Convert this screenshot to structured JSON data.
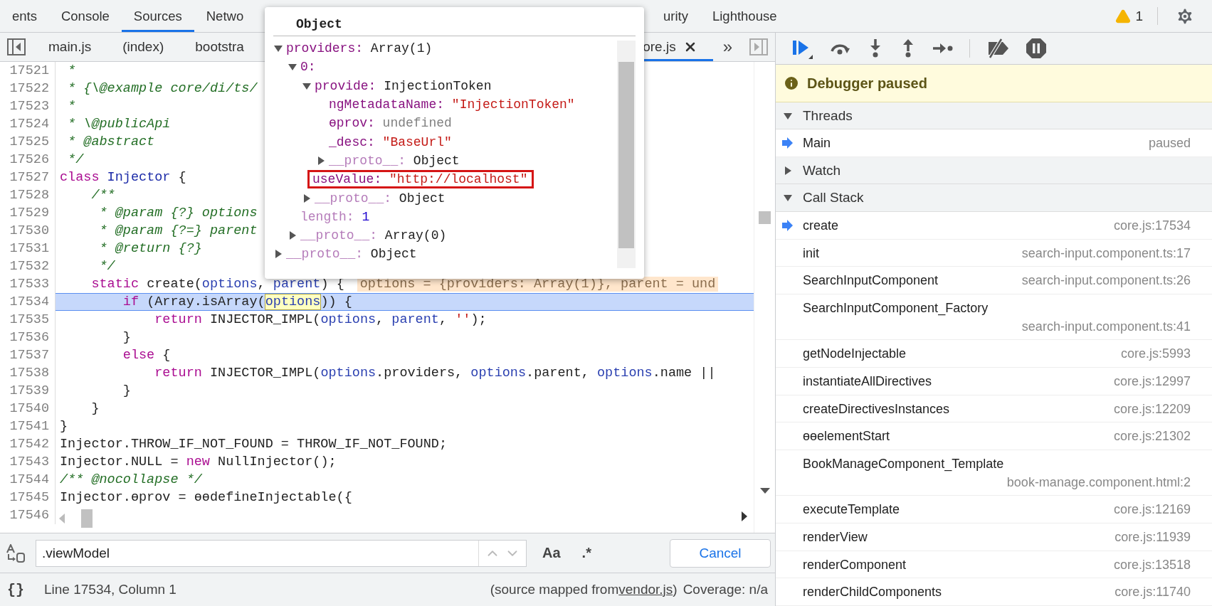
{
  "tabs": [
    {
      "label": "ents",
      "selected": false
    },
    {
      "label": "Console",
      "selected": false
    },
    {
      "label": "Sources",
      "selected": true
    },
    {
      "label": "Netwo",
      "selected": false
    },
    {
      "label": "urity",
      "selected": false
    },
    {
      "label": "Lighthouse",
      "selected": false
    }
  ],
  "warnings": "1",
  "file_tabs": [
    {
      "label": "main.js",
      "selected": false
    },
    {
      "label": "(index)",
      "selected": false
    },
    {
      "label": "bootstra",
      "selected": false
    },
    {
      "label": "ore.js",
      "selected": true
    }
  ],
  "file_tabs_overflow": "»",
  "code_lines": [
    {
      "number": "17521",
      "current": false,
      "segments": [
        {
          "kind": "comment",
          "text": " *"
        }
      ]
    },
    {
      "number": "17522",
      "current": false,
      "segments": [
        {
          "kind": "comment",
          "text": " * {\\@example core/di/ts/"
        }
      ]
    },
    {
      "number": "17523",
      "current": false,
      "segments": [
        {
          "kind": "comment",
          "text": " *"
        }
      ]
    },
    {
      "number": "17524",
      "current": false,
      "segments": [
        {
          "kind": "comment",
          "text": " * \\@publicApi"
        }
      ]
    },
    {
      "number": "17525",
      "current": false,
      "segments": [
        {
          "kind": "comment",
          "text": " * @abstract"
        }
      ]
    },
    {
      "number": "17526",
      "current": false,
      "segments": [
        {
          "kind": "comment",
          "text": " */"
        }
      ]
    },
    {
      "number": "17527",
      "current": false,
      "segments": [
        {
          "kind": "keyword",
          "text": "class"
        },
        {
          "kind": "def",
          "text": " Injector"
        },
        {
          "kind": "plain",
          "text": " {"
        }
      ]
    },
    {
      "number": "17528",
      "current": false,
      "segments": [
        {
          "kind": "comment",
          "text": "    /**"
        }
      ]
    },
    {
      "number": "17529",
      "current": false,
      "segments": [
        {
          "kind": "comment",
          "text": "     * @param {?} options"
        }
      ]
    },
    {
      "number": "17530",
      "current": false,
      "segments": [
        {
          "kind": "comment",
          "text": "     * @param {?=} parent"
        }
      ]
    },
    {
      "number": "17531",
      "current": false,
      "segments": [
        {
          "kind": "comment",
          "text": "     * @return {?}"
        }
      ]
    },
    {
      "number": "17532",
      "current": false,
      "segments": [
        {
          "kind": "comment",
          "text": "     */"
        }
      ]
    },
    {
      "number": "17533",
      "current": false,
      "segments": [
        {
          "kind": "keyword",
          "text": "    static"
        },
        {
          "kind": "plain",
          "text": " create("
        },
        {
          "kind": "var",
          "text": "options"
        },
        {
          "kind": "plain",
          "text": ", "
        },
        {
          "kind": "var",
          "text": "parent"
        },
        {
          "kind": "plain",
          "text": ") {"
        }
      ],
      "inline_value": "options = {providers: Array(1)}, parent = und"
    },
    {
      "number": "17534",
      "current": true,
      "segments": [
        {
          "kind": "keyword",
          "text": "        if"
        },
        {
          "kind": "plain",
          "text": " (Array.isArray("
        },
        {
          "kind": "match",
          "text": "options"
        },
        {
          "kind": "plain",
          "text": ")) {"
        }
      ]
    },
    {
      "number": "17535",
      "current": false,
      "segments": [
        {
          "kind": "keyword",
          "text": "            return"
        },
        {
          "kind": "plain",
          "text": " INJECTOR_IMPL("
        },
        {
          "kind": "var",
          "text": "options"
        },
        {
          "kind": "plain",
          "text": ", "
        },
        {
          "kind": "var",
          "text": "parent"
        },
        {
          "kind": "plain",
          "text": ", "
        },
        {
          "kind": "string",
          "text": "''"
        },
        {
          "kind": "plain",
          "text": ");"
        }
      ]
    },
    {
      "number": "17536",
      "current": false,
      "segments": [
        {
          "kind": "plain",
          "text": "        }"
        }
      ]
    },
    {
      "number": "17537",
      "current": false,
      "segments": [
        {
          "kind": "keyword",
          "text": "        else"
        },
        {
          "kind": "plain",
          "text": " {"
        }
      ]
    },
    {
      "number": "17538",
      "current": false,
      "segments": [
        {
          "kind": "keyword",
          "text": "            return"
        },
        {
          "kind": "plain",
          "text": " INJECTOR_IMPL("
        },
        {
          "kind": "var",
          "text": "options"
        },
        {
          "kind": "plain",
          "text": ".providers, "
        },
        {
          "kind": "var",
          "text": "options"
        },
        {
          "kind": "plain",
          "text": ".parent, "
        },
        {
          "kind": "var",
          "text": "options"
        },
        {
          "kind": "plain",
          "text": ".name ||"
        }
      ]
    },
    {
      "number": "17539",
      "current": false,
      "segments": [
        {
          "kind": "plain",
          "text": "        }"
        }
      ]
    },
    {
      "number": "17540",
      "current": false,
      "segments": [
        {
          "kind": "plain",
          "text": "    }"
        }
      ]
    },
    {
      "number": "17541",
      "current": false,
      "segments": [
        {
          "kind": "plain",
          "text": "}"
        }
      ]
    },
    {
      "number": "17542",
      "current": false,
      "segments": [
        {
          "kind": "plain",
          "text": "Injector.THROW_IF_NOT_FOUND = THROW_IF_NOT_FOUND;"
        }
      ]
    },
    {
      "number": "17543",
      "current": false,
      "segments": [
        {
          "kind": "plain",
          "text": "Injector.NULL = "
        },
        {
          "kind": "keyword",
          "text": "new"
        },
        {
          "kind": "plain",
          "text": " NullInjector();"
        }
      ]
    },
    {
      "number": "17544",
      "current": false,
      "segments": [
        {
          "kind": "comment",
          "text": "/** @nocollapse */"
        }
      ]
    },
    {
      "number": "17545",
      "current": false,
      "segments": [
        {
          "kind": "plain",
          "text": "Injector.ɵprov = ɵɵdefineInjectable({"
        }
      ]
    },
    {
      "number": "17546",
      "current": false
    }
  ],
  "popup": {
    "title": "Object",
    "tree": [
      {
        "key": "providers:",
        "value": "Array(1)",
        "kind": "object",
        "internal": false,
        "expanded": true,
        "outlined": false,
        "children": [
          {
            "key": "0:",
            "kind": "none",
            "internal": false,
            "expanded": true,
            "outlined": false,
            "children": [
              {
                "key": "provide:",
                "value": "InjectionToken",
                "kind": "object",
                "internal": false,
                "expanded": true,
                "outlined": false,
                "children": [
                  {
                    "key": "ngMetadataName:",
                    "value": "\"InjectionToken\"",
                    "kind": "string",
                    "internal": false,
                    "outlined": false
                  },
                  {
                    "key": "ɵprov:",
                    "value": "undefined",
                    "kind": "undefined",
                    "internal": false,
                    "outlined": false
                  },
                  {
                    "key": "_desc:",
                    "value": "\"BaseUrl\"",
                    "kind": "string",
                    "internal": false,
                    "outlined": false
                  },
                  {
                    "key": "__proto__:",
                    "value": "Object",
                    "kind": "object",
                    "internal": true,
                    "expanded": false,
                    "outlined": false
                  }
                ]
              },
              {
                "key": "useValue:",
                "value": "\"http://localhost\"",
                "kind": "string",
                "internal": false,
                "outlined": true
              },
              {
                "key": "__proto__:",
                "value": "Object",
                "kind": "object",
                "internal": true,
                "expanded": false,
                "outlined": false
              }
            ]
          },
          {
            "key": "length:",
            "value": "1",
            "kind": "number",
            "internal": true,
            "outlined": false
          },
          {
            "key": "__proto__:",
            "value": "Array(0)",
            "kind": "object",
            "internal": true,
            "expanded": false,
            "outlined": false
          }
        ]
      },
      {
        "key": "__proto__:",
        "value": "Object",
        "kind": "object",
        "internal": true,
        "expanded": false,
        "outlined": false
      }
    ]
  },
  "search": {
    "value": ".viewModel",
    "match_case": "Aa",
    "regex": ".*",
    "cancel": "Cancel"
  },
  "status_bar": {
    "pretty_print": "{}",
    "position": "Line 17534, Column 1",
    "mapped_prefix": "(source mapped from ",
    "mapped_link": "vendor.js",
    "mapped_suffix": ")",
    "coverage": "Coverage: n/a"
  },
  "paused_banner": "Debugger paused",
  "sections": [
    {
      "kind": "threads",
      "title": "Threads",
      "expanded": true,
      "items": [
        {
          "name": "Main",
          "location": "paused",
          "current": true
        }
      ]
    },
    {
      "kind": "watch",
      "title": "Watch",
      "expanded": false
    },
    {
      "kind": "call_stack",
      "title": "Call Stack",
      "expanded": true,
      "items": [
        {
          "name": "create",
          "location": "core.js:17534",
          "current": true
        },
        {
          "name": "init",
          "location": "search-input.component.ts:17",
          "current": false
        },
        {
          "name": "SearchInputComponent",
          "location": "search-input.component.ts:26",
          "current": false
        },
        {
          "name": "SearchInputComponent_Factory",
          "location": "search-input.component.ts:41",
          "current": false
        },
        {
          "name": "getNodeInjectable",
          "location": "core.js:5993",
          "current": false
        },
        {
          "name": "instantiateAllDirectives",
          "location": "core.js:12997",
          "current": false
        },
        {
          "name": "createDirectivesInstances",
          "location": "core.js:12209",
          "current": false
        },
        {
          "name": "ɵɵelementStart",
          "location": "core.js:21302",
          "current": false
        },
        {
          "name": "BookManageComponent_Template",
          "location": "book-manage.component.html:2",
          "current": false
        },
        {
          "name": "executeTemplate",
          "location": "core.js:12169",
          "current": false
        },
        {
          "name": "renderView",
          "location": "core.js:11939",
          "current": false
        },
        {
          "name": "renderComponent",
          "location": "core.js:13518",
          "current": false
        },
        {
          "name": "renderChildComponents",
          "location": "core.js:11740",
          "current": false
        }
      ]
    }
  ]
}
